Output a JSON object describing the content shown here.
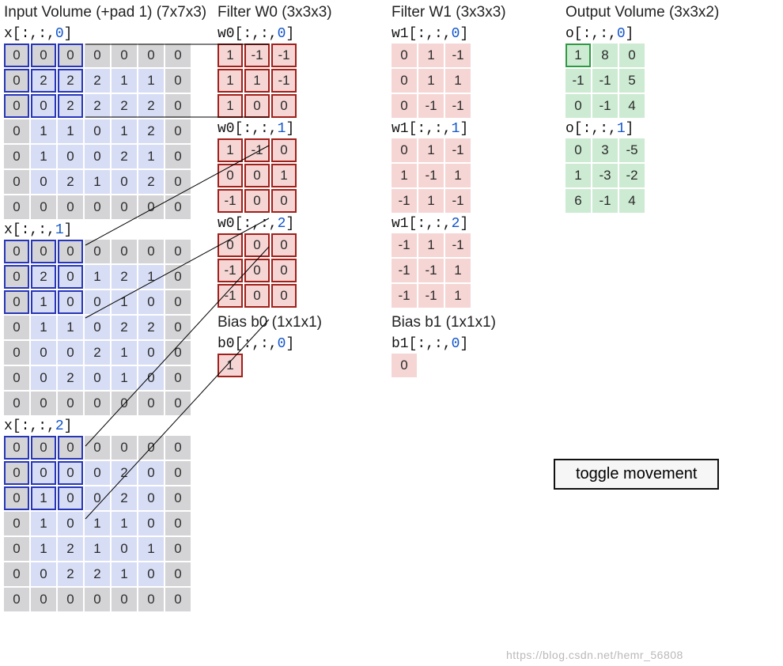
{
  "headers": {
    "input": "Input Volume (+pad 1) (7x7x3)",
    "w0": "Filter W0 (3x3x3)",
    "w1": "Filter W1 (3x3x3)",
    "output": "Output Volume (3x3x2)",
    "b0": "Bias b0 (1x1x1)",
    "b1": "Bias b1 (1x1x1)"
  },
  "labels": {
    "x0": "x[:,:,0]",
    "x1": "x[:,:,1]",
    "x2": "x[:,:,2]",
    "w00": "w0[:,:,0]",
    "w01": "w0[:,:,1]",
    "w02": "w0[:,:,2]",
    "w10": "w1[:,:,0]",
    "w11": "w1[:,:,1]",
    "w12": "w1[:,:,2]",
    "o0": "o[:,:,0]",
    "o1": "o[:,:,1]",
    "b0": "b0[:,:,0]",
    "b1": "b1[:,:,0]"
  },
  "input": {
    "slice0": [
      [
        0,
        0,
        0,
        0,
        0,
        0,
        0
      ],
      [
        0,
        2,
        2,
        2,
        1,
        1,
        0
      ],
      [
        0,
        0,
        2,
        2,
        2,
        2,
        0
      ],
      [
        0,
        1,
        1,
        0,
        1,
        2,
        0
      ],
      [
        0,
        1,
        0,
        0,
        2,
        1,
        0
      ],
      [
        0,
        0,
        2,
        1,
        0,
        2,
        0
      ],
      [
        0,
        0,
        0,
        0,
        0,
        0,
        0
      ]
    ],
    "slice1": [
      [
        0,
        0,
        0,
        0,
        0,
        0,
        0
      ],
      [
        0,
        2,
        0,
        1,
        2,
        1,
        0
      ],
      [
        0,
        1,
        0,
        0,
        1,
        0,
        0
      ],
      [
        0,
        1,
        1,
        0,
        2,
        2,
        0
      ],
      [
        0,
        0,
        0,
        2,
        1,
        0,
        0
      ],
      [
        0,
        0,
        2,
        0,
        1,
        0,
        0
      ],
      [
        0,
        0,
        0,
        0,
        0,
        0,
        0
      ]
    ],
    "slice2": [
      [
        0,
        0,
        0,
        0,
        0,
        0,
        0
      ],
      [
        0,
        0,
        0,
        0,
        2,
        0,
        0
      ],
      [
        0,
        1,
        0,
        0,
        2,
        0,
        0
      ],
      [
        0,
        1,
        0,
        1,
        1,
        0,
        0
      ],
      [
        0,
        1,
        2,
        1,
        0,
        1,
        0
      ],
      [
        0,
        0,
        2,
        2,
        1,
        0,
        0
      ],
      [
        0,
        0,
        0,
        0,
        0,
        0,
        0
      ]
    ]
  },
  "w0": {
    "slice0": [
      [
        1,
        -1,
        -1
      ],
      [
        1,
        1,
        -1
      ],
      [
        1,
        0,
        0
      ]
    ],
    "slice1": [
      [
        1,
        -1,
        0
      ],
      [
        0,
        0,
        1
      ],
      [
        -1,
        0,
        0
      ]
    ],
    "slice2": [
      [
        0,
        0,
        0
      ],
      [
        -1,
        0,
        0
      ],
      [
        -1,
        0,
        0
      ]
    ]
  },
  "w1": {
    "slice0": [
      [
        0,
        1,
        -1
      ],
      [
        0,
        1,
        1
      ],
      [
        0,
        -1,
        -1
      ]
    ],
    "slice1": [
      [
        0,
        1,
        -1
      ],
      [
        1,
        -1,
        1
      ],
      [
        -1,
        1,
        -1
      ]
    ],
    "slice2": [
      [
        -1,
        1,
        -1
      ],
      [
        -1,
        -1,
        1
      ],
      [
        -1,
        -1,
        1
      ]
    ]
  },
  "bias": {
    "b0": 1,
    "b1": 0
  },
  "output": {
    "slice0": [
      [
        1,
        8,
        0
      ],
      [
        -1,
        -1,
        5
      ],
      [
        0,
        -1,
        4
      ]
    ],
    "slice1": [
      [
        0,
        3,
        -5
      ],
      [
        1,
        -3,
        -2
      ],
      [
        6,
        -1,
        4
      ]
    ]
  },
  "toggle_label": "toggle movement",
  "watermark": "https://blog.csdn.net/hemr_56808",
  "chart_data": {
    "type": "table",
    "description": "CNN convolution demo: 7x7x3 padded input, two 3x3x3 filters W0/W1 with biases b0/b1, producing 3x3x2 output. Current receptive field is top-left 3x3 region (rows 0-2, cols 0-2) across all 3 input slices, highlighted in blue; W0 slices highlighted in red; output o[0,0,0]=1 highlighted in green.",
    "input_shape": [
      7,
      7,
      3
    ],
    "filter_shape": [
      3,
      3,
      3
    ],
    "num_filters": 2,
    "output_shape": [
      3,
      3,
      2
    ],
    "highlight": {
      "input_window": {
        "row": 0,
        "col": 0,
        "size": 3
      },
      "output_cell": {
        "slice": 0,
        "row": 0,
        "col": 0
      }
    }
  }
}
